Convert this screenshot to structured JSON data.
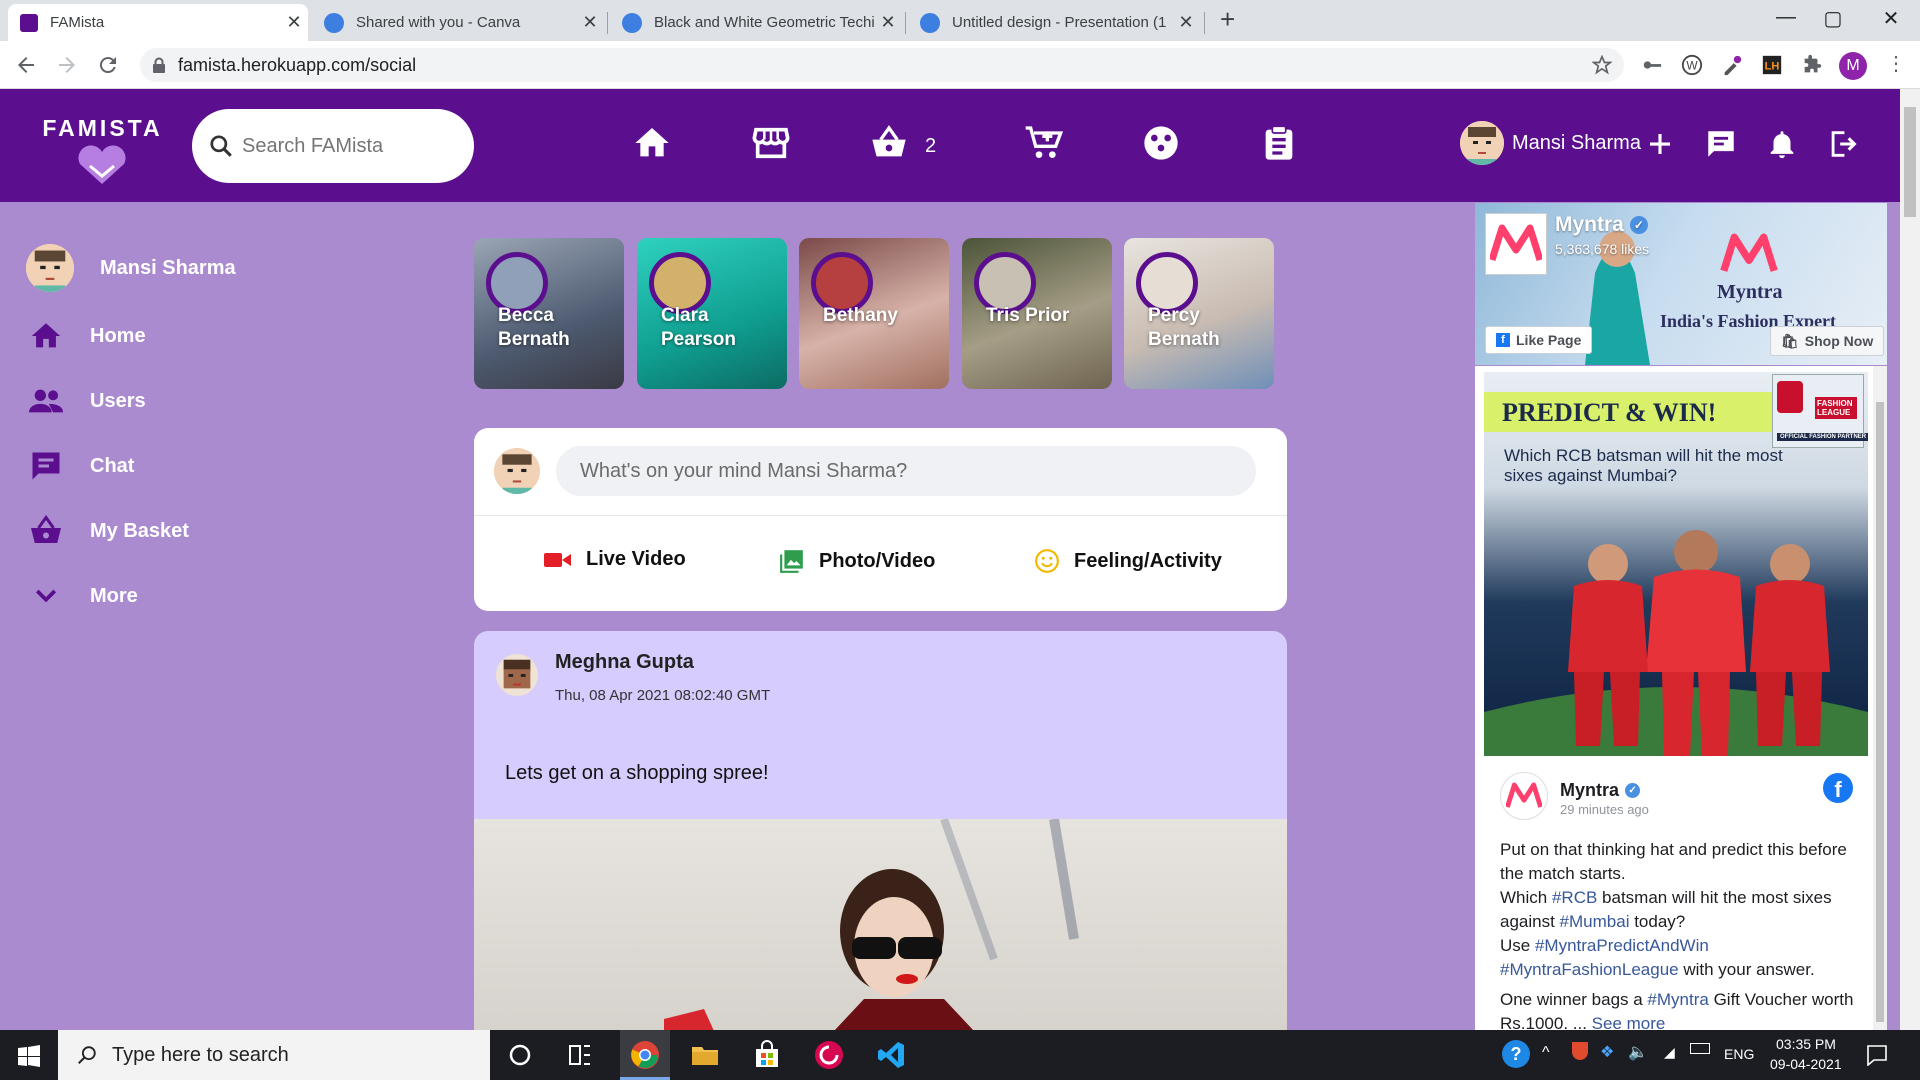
{
  "browser": {
    "tabs": [
      {
        "title": "FAMista",
        "active": true
      },
      {
        "title": "Shared with you - Canva",
        "active": false
      },
      {
        "title": "Black and White Geometric Techi",
        "active": false
      },
      {
        "title": "Untitled design - Presentation (1",
        "active": false
      }
    ],
    "new_tab": "+",
    "url": "famista.herokuapp.com/social",
    "profile_initial": "M"
  },
  "header": {
    "logo_text": "FAMISTA",
    "search_placeholder": "Search FAMista",
    "basket_count": "2",
    "user_name": "Mansi Sharma"
  },
  "sidebar": {
    "user_name": "Mansi Sharma",
    "items": [
      {
        "label": "Home",
        "icon": "home-icon"
      },
      {
        "label": "Users",
        "icon": "users-icon"
      },
      {
        "label": "Chat",
        "icon": "chat-icon"
      },
      {
        "label": "My Basket",
        "icon": "basket-icon"
      },
      {
        "label": "More",
        "icon": "chevron-down-icon"
      }
    ]
  },
  "stories": [
    {
      "name": "Becca Bernath",
      "bg": "#6f7f95"
    },
    {
      "name": "Clara Pearson",
      "bg": "#11b1a2"
    },
    {
      "name": "Bethany",
      "bg": "#b88878"
    },
    {
      "name": "Tris Prior",
      "bg": "#7d7a64"
    },
    {
      "name": "Percy Bernath",
      "bg": "#cfc6bd"
    }
  ],
  "composer": {
    "placeholder": "What's on your mind Mansi Sharma?",
    "actions": [
      {
        "label": "Live Video",
        "color": "#e41e26"
      },
      {
        "label": "Photo/Video",
        "color": "#2e9d4d"
      },
      {
        "label": "Feeling/Activity",
        "color": "#f5b800"
      }
    ]
  },
  "post": {
    "author": "Meghna Gupta",
    "date": "Thu, 08 Apr 2021 08:02:40 GMT",
    "text": "Lets get on a shopping spree!"
  },
  "ad_page": {
    "name": "Myntra",
    "likes": "5,363,678 likes",
    "brand": "Myntra",
    "tagline": "India's Fashion Expert",
    "like_button": "Like Page",
    "shop_button": "Shop Now"
  },
  "ad_post": {
    "banner_title": "PREDICT & WIN!",
    "banner_question": "Which RCB batsman will hit the most sixes against Mumbai?",
    "badge": "FASHION LEAGUE",
    "badge_sub": "OFFICIAL FASHION PARTNER",
    "page_name": "Myntra",
    "time": "29 minutes ago",
    "line1": "Put on that thinking hat and predict this before the match starts.",
    "line2_pre": "Which ",
    "line2_tag": "#RCB",
    "line2_post": " batsman will hit the most sixes against ",
    "line2_tag2": "#Mumbai",
    "line2_end": " today?",
    "line3_pre": "Use ",
    "line3_tag": "#MyntraPredictAndWin",
    "line3_tag2": "#MyntraFashionLeague",
    "line3_end": " with your answer.",
    "line4_pre": "One winner bags a ",
    "line4_tag": "#Myntra",
    "line4_post": " Gift Voucher worth Rs.1000. ... ",
    "see_more": "See more"
  },
  "taskbar": {
    "search_placeholder": "Type here to search",
    "lang": "ENG",
    "time": "03:35 PM",
    "date": "09-04-2021"
  },
  "colors": {
    "header": "#5b0f8f",
    "page": "#ab8bcf",
    "post": "#d6ccfd",
    "link": "#385898"
  }
}
